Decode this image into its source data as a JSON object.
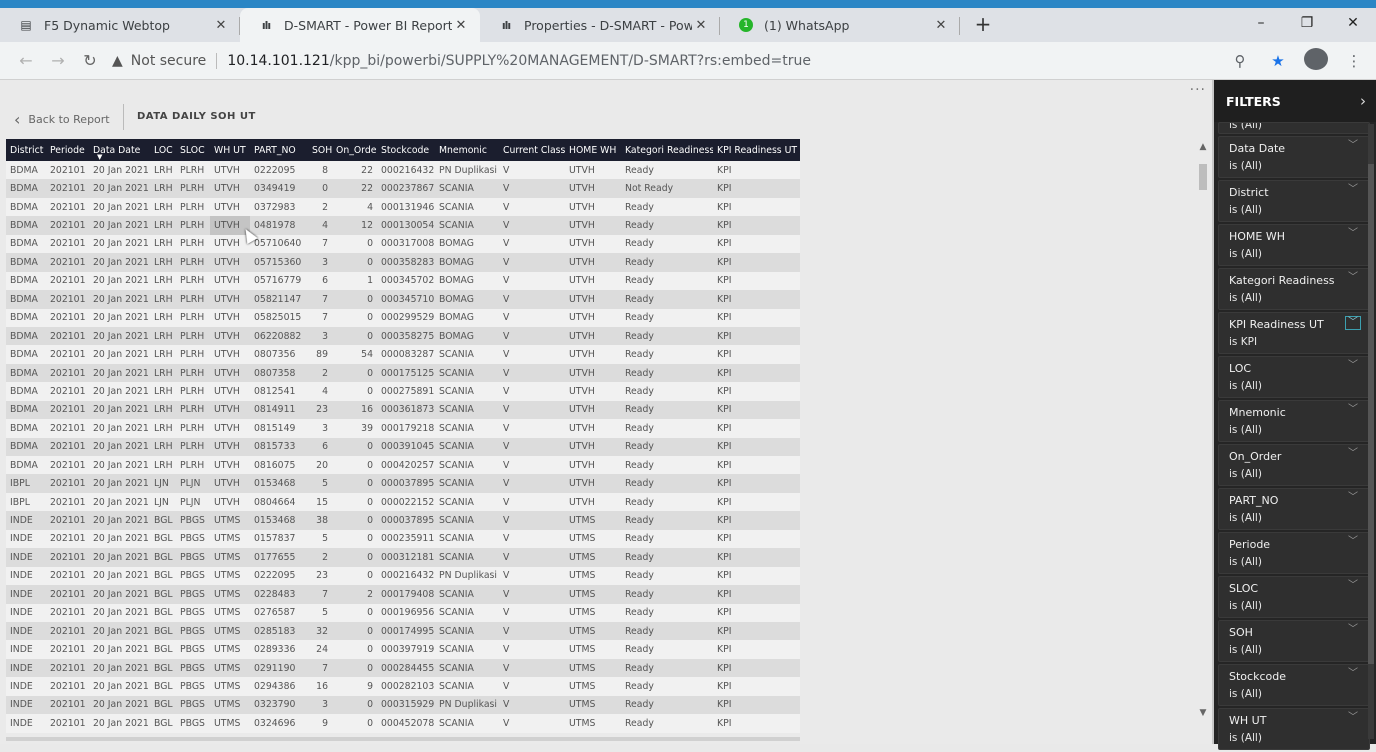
{
  "browser": {
    "tabs": [
      {
        "icon": "document-icon",
        "label": "F5 Dynamic Webtop",
        "active": false
      },
      {
        "icon": "powerbi-icon",
        "label": "D-SMART - Power BI Report Serv",
        "active": true
      },
      {
        "icon": "powerbi-icon",
        "label": "Properties - D-SMART - Power B",
        "active": false
      },
      {
        "icon": "whatsapp-icon",
        "label": "(1) WhatsApp",
        "active": false
      }
    ],
    "new_tab": "+",
    "window_controls": {
      "minimize": "–",
      "restore": "❐",
      "close": "✕"
    },
    "security_label": "Not secure",
    "url_host": "10.14.101.121",
    "url_path": "/kpp_bi/powerbi/SUPPLY%20MANAGEMENT/D-SMART?rs:embed=true"
  },
  "report": {
    "back_label": "Back to Report",
    "page_title": "DATA DAILY SOH UT",
    "more_label": "···",
    "sorted_column": "Data Date",
    "columns": [
      "District",
      "Periode",
      "Data Date",
      "LOC",
      "SLOC",
      "WH UT",
      "PART_NO",
      "SOH",
      "On_Order",
      "Stockcode",
      "Mnemonic",
      "Current Class",
      "HOME WH",
      "Kategori Readiness",
      "KPI Readiness UT"
    ],
    "rows": [
      [
        "BDMA",
        "202101",
        "20 Jan 2021",
        "LRH",
        "PLRH",
        "UTVH",
        "0222095",
        "8",
        "22",
        "000216432",
        "PN Duplikasi",
        "V",
        "UTVH",
        "Ready",
        "KPI"
      ],
      [
        "BDMA",
        "202101",
        "20 Jan 2021",
        "LRH",
        "PLRH",
        "UTVH",
        "0349419",
        "0",
        "22",
        "000237867",
        "SCANIA",
        "V",
        "UTVH",
        "Not Ready",
        "KPI"
      ],
      [
        "BDMA",
        "202101",
        "20 Jan 2021",
        "LRH",
        "PLRH",
        "UTVH",
        "0372983",
        "2",
        "4",
        "000131946",
        "SCANIA",
        "V",
        "UTVH",
        "Ready",
        "KPI"
      ],
      [
        "BDMA",
        "202101",
        "20 Jan 2021",
        "LRH",
        "PLRH",
        "UTVH",
        "0481978",
        "4",
        "12",
        "000130054",
        "SCANIA",
        "V",
        "UTVH",
        "Ready",
        "KPI"
      ],
      [
        "BDMA",
        "202101",
        "20 Jan 2021",
        "LRH",
        "PLRH",
        "UTVH",
        "05710640",
        "7",
        "0",
        "000317008",
        "BOMAG",
        "V",
        "UTVH",
        "Ready",
        "KPI"
      ],
      [
        "BDMA",
        "202101",
        "20 Jan 2021",
        "LRH",
        "PLRH",
        "UTVH",
        "05715360",
        "3",
        "0",
        "000358283",
        "BOMAG",
        "V",
        "UTVH",
        "Ready",
        "KPI"
      ],
      [
        "BDMA",
        "202101",
        "20 Jan 2021",
        "LRH",
        "PLRH",
        "UTVH",
        "05716779",
        "6",
        "1",
        "000345702",
        "BOMAG",
        "V",
        "UTVH",
        "Ready",
        "KPI"
      ],
      [
        "BDMA",
        "202101",
        "20 Jan 2021",
        "LRH",
        "PLRH",
        "UTVH",
        "05821147",
        "7",
        "0",
        "000345710",
        "BOMAG",
        "V",
        "UTVH",
        "Ready",
        "KPI"
      ],
      [
        "BDMA",
        "202101",
        "20 Jan 2021",
        "LRH",
        "PLRH",
        "UTVH",
        "05825015",
        "7",
        "0",
        "000299529",
        "BOMAG",
        "V",
        "UTVH",
        "Ready",
        "KPI"
      ],
      [
        "BDMA",
        "202101",
        "20 Jan 2021",
        "LRH",
        "PLRH",
        "UTVH",
        "06220882",
        "3",
        "0",
        "000358275",
        "BOMAG",
        "V",
        "UTVH",
        "Ready",
        "KPI"
      ],
      [
        "BDMA",
        "202101",
        "20 Jan 2021",
        "LRH",
        "PLRH",
        "UTVH",
        "0807356",
        "89",
        "54",
        "000083287",
        "SCANIA",
        "V",
        "UTVH",
        "Ready",
        "KPI"
      ],
      [
        "BDMA",
        "202101",
        "20 Jan 2021",
        "LRH",
        "PLRH",
        "UTVH",
        "0807358",
        "2",
        "0",
        "000175125",
        "SCANIA",
        "V",
        "UTVH",
        "Ready",
        "KPI"
      ],
      [
        "BDMA",
        "202101",
        "20 Jan 2021",
        "LRH",
        "PLRH",
        "UTVH",
        "0812541",
        "4",
        "0",
        "000275891",
        "SCANIA",
        "V",
        "UTVH",
        "Ready",
        "KPI"
      ],
      [
        "BDMA",
        "202101",
        "20 Jan 2021",
        "LRH",
        "PLRH",
        "UTVH",
        "0814911",
        "23",
        "16",
        "000361873",
        "SCANIA",
        "V",
        "UTVH",
        "Ready",
        "KPI"
      ],
      [
        "BDMA",
        "202101",
        "20 Jan 2021",
        "LRH",
        "PLRH",
        "UTVH",
        "0815149",
        "3",
        "39",
        "000179218",
        "SCANIA",
        "V",
        "UTVH",
        "Ready",
        "KPI"
      ],
      [
        "BDMA",
        "202101",
        "20 Jan 2021",
        "LRH",
        "PLRH",
        "UTVH",
        "0815733",
        "6",
        "0",
        "000391045",
        "SCANIA",
        "V",
        "UTVH",
        "Ready",
        "KPI"
      ],
      [
        "BDMA",
        "202101",
        "20 Jan 2021",
        "LRH",
        "PLRH",
        "UTVH",
        "0816075",
        "20",
        "0",
        "000420257",
        "SCANIA",
        "V",
        "UTVH",
        "Ready",
        "KPI"
      ],
      [
        "IBPL",
        "202101",
        "20 Jan 2021",
        "LJN",
        "PLJN",
        "UTVH",
        "0153468",
        "5",
        "0",
        "000037895",
        "SCANIA",
        "V",
        "UTVH",
        "Ready",
        "KPI"
      ],
      [
        "IBPL",
        "202101",
        "20 Jan 2021",
        "LJN",
        "PLJN",
        "UTVH",
        "0804664",
        "15",
        "0",
        "000022152",
        "SCANIA",
        "V",
        "UTVH",
        "Ready",
        "KPI"
      ],
      [
        "INDE",
        "202101",
        "20 Jan 2021",
        "BGL",
        "PBGS",
        "UTMS",
        "0153468",
        "38",
        "0",
        "000037895",
        "SCANIA",
        "V",
        "UTMS",
        "Ready",
        "KPI"
      ],
      [
        "INDE",
        "202101",
        "20 Jan 2021",
        "BGL",
        "PBGS",
        "UTMS",
        "0157837",
        "5",
        "0",
        "000235911",
        "SCANIA",
        "V",
        "UTMS",
        "Ready",
        "KPI"
      ],
      [
        "INDE",
        "202101",
        "20 Jan 2021",
        "BGL",
        "PBGS",
        "UTMS",
        "0177655",
        "2",
        "0",
        "000312181",
        "SCANIA",
        "V",
        "UTMS",
        "Ready",
        "KPI"
      ],
      [
        "INDE",
        "202101",
        "20 Jan 2021",
        "BGL",
        "PBGS",
        "UTMS",
        "0222095",
        "23",
        "0",
        "000216432",
        "PN Duplikasi",
        "V",
        "UTMS",
        "Ready",
        "KPI"
      ],
      [
        "INDE",
        "202101",
        "20 Jan 2021",
        "BGL",
        "PBGS",
        "UTMS",
        "0228483",
        "7",
        "2",
        "000179408",
        "SCANIA",
        "V",
        "UTMS",
        "Ready",
        "KPI"
      ],
      [
        "INDE",
        "202101",
        "20 Jan 2021",
        "BGL",
        "PBGS",
        "UTMS",
        "0276587",
        "5",
        "0",
        "000196956",
        "SCANIA",
        "V",
        "UTMS",
        "Ready",
        "KPI"
      ],
      [
        "INDE",
        "202101",
        "20 Jan 2021",
        "BGL",
        "PBGS",
        "UTMS",
        "0285183",
        "32",
        "0",
        "000174995",
        "SCANIA",
        "V",
        "UTMS",
        "Ready",
        "KPI"
      ],
      [
        "INDE",
        "202101",
        "20 Jan 2021",
        "BGL",
        "PBGS",
        "UTMS",
        "0289336",
        "24",
        "0",
        "000397919",
        "SCANIA",
        "V",
        "UTMS",
        "Ready",
        "KPI"
      ],
      [
        "INDE",
        "202101",
        "20 Jan 2021",
        "BGL",
        "PBGS",
        "UTMS",
        "0291190",
        "7",
        "0",
        "000284455",
        "SCANIA",
        "V",
        "UTMS",
        "Ready",
        "KPI"
      ],
      [
        "INDE",
        "202101",
        "20 Jan 2021",
        "BGL",
        "PBGS",
        "UTMS",
        "0294386",
        "16",
        "9",
        "000282103",
        "SCANIA",
        "V",
        "UTMS",
        "Ready",
        "KPI"
      ],
      [
        "INDE",
        "202101",
        "20 Jan 2021",
        "BGL",
        "PBGS",
        "UTMS",
        "0323790",
        "3",
        "0",
        "000315929",
        "PN Duplikasi",
        "V",
        "UTMS",
        "Ready",
        "KPI"
      ],
      [
        "INDE",
        "202101",
        "20 Jan 2021",
        "BGL",
        "PBGS",
        "UTMS",
        "0324696",
        "9",
        "0",
        "000452078",
        "SCANIA",
        "V",
        "UTMS",
        "Ready",
        "KPI"
      ]
    ]
  },
  "filters": {
    "title": "FILTERS",
    "partial_top_value": "is (All)",
    "items": [
      {
        "name": "Data Date",
        "value": "is (All)",
        "active": false
      },
      {
        "name": "District",
        "value": "is (All)",
        "active": false
      },
      {
        "name": "HOME WH",
        "value": "is (All)",
        "active": false
      },
      {
        "name": "Kategori Readiness",
        "value": "is (All)",
        "active": false
      },
      {
        "name": "KPI Readiness UT",
        "value": "is KPI",
        "active": true
      },
      {
        "name": "LOC",
        "value": "is (All)",
        "active": false
      },
      {
        "name": "Mnemonic",
        "value": "is (All)",
        "active": false
      },
      {
        "name": "On_Order",
        "value": "is (All)",
        "active": false
      },
      {
        "name": "PART_NO",
        "value": "is (All)",
        "active": false
      },
      {
        "name": "Periode",
        "value": "is (All)",
        "active": false
      },
      {
        "name": "SLOC",
        "value": "is (All)",
        "active": false
      },
      {
        "name": "SOH",
        "value": "is (All)",
        "active": false
      },
      {
        "name": "Stockcode",
        "value": "is (All)",
        "active": false
      },
      {
        "name": "WH UT",
        "value": "is (All)",
        "active": false
      }
    ]
  },
  "colors": {
    "header_bg": "#1b1e2e",
    "filter_panel_bg": "#252525",
    "accent_blue": "#2b86c5",
    "active_filter_border": "#3ca0b0"
  }
}
